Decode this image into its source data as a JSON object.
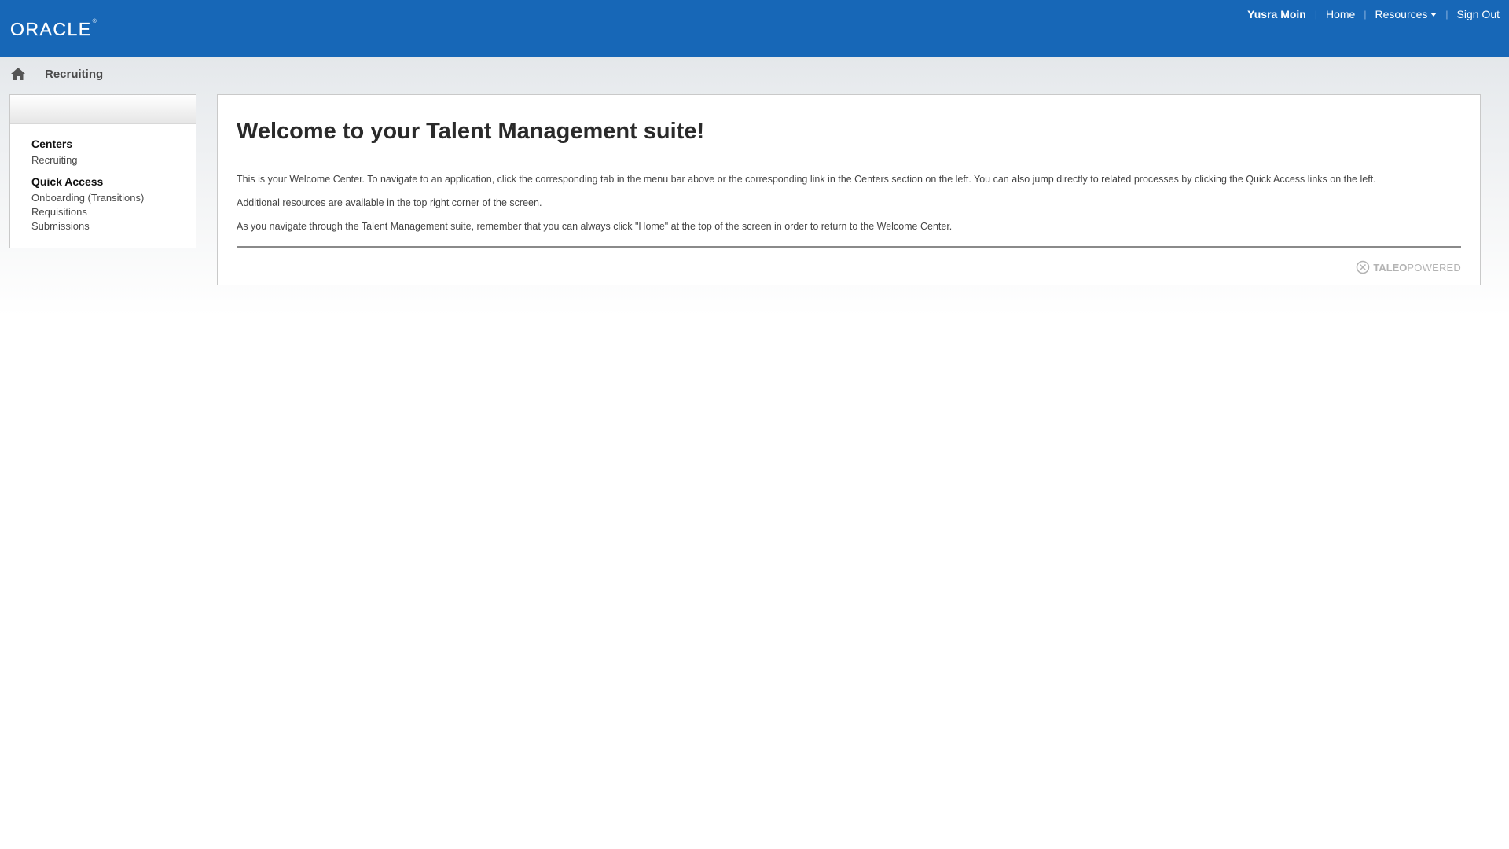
{
  "header": {
    "logo_text": "ORACLE",
    "logo_mark": "®",
    "user_name": "Yusra Moin",
    "nav": {
      "home": "Home",
      "resources": "Resources",
      "sign_out": "Sign Out"
    },
    "separator": "|",
    "bar_color": "#1767b7"
  },
  "breadcrumb": {
    "icon": "home-icon",
    "label": "Recruiting"
  },
  "sidebar": {
    "centers_title": "Centers",
    "centers_items": [
      "Recruiting"
    ],
    "quick_access_title": "Quick Access",
    "quick_access_items": [
      "Onboarding (Transitions)",
      "Requisitions",
      "Submissions"
    ]
  },
  "main": {
    "title": "Welcome to your Talent Management suite!",
    "paragraphs": [
      "This is your Welcome Center. To navigate to an application, click the corresponding tab in the menu bar above or the corresponding link in the Centers section on the left. You can also jump directly to related processes by clicking the Quick Access links on the left.",
      "Additional resources are available in the top right corner of the screen.",
      "As you navigate through the Talent Management suite, remember that you can always click \"Home\" at the top of the screen in order to return to the Welcome Center."
    ],
    "footer_brand": "TALEO",
    "footer_powered": "POWERED"
  }
}
